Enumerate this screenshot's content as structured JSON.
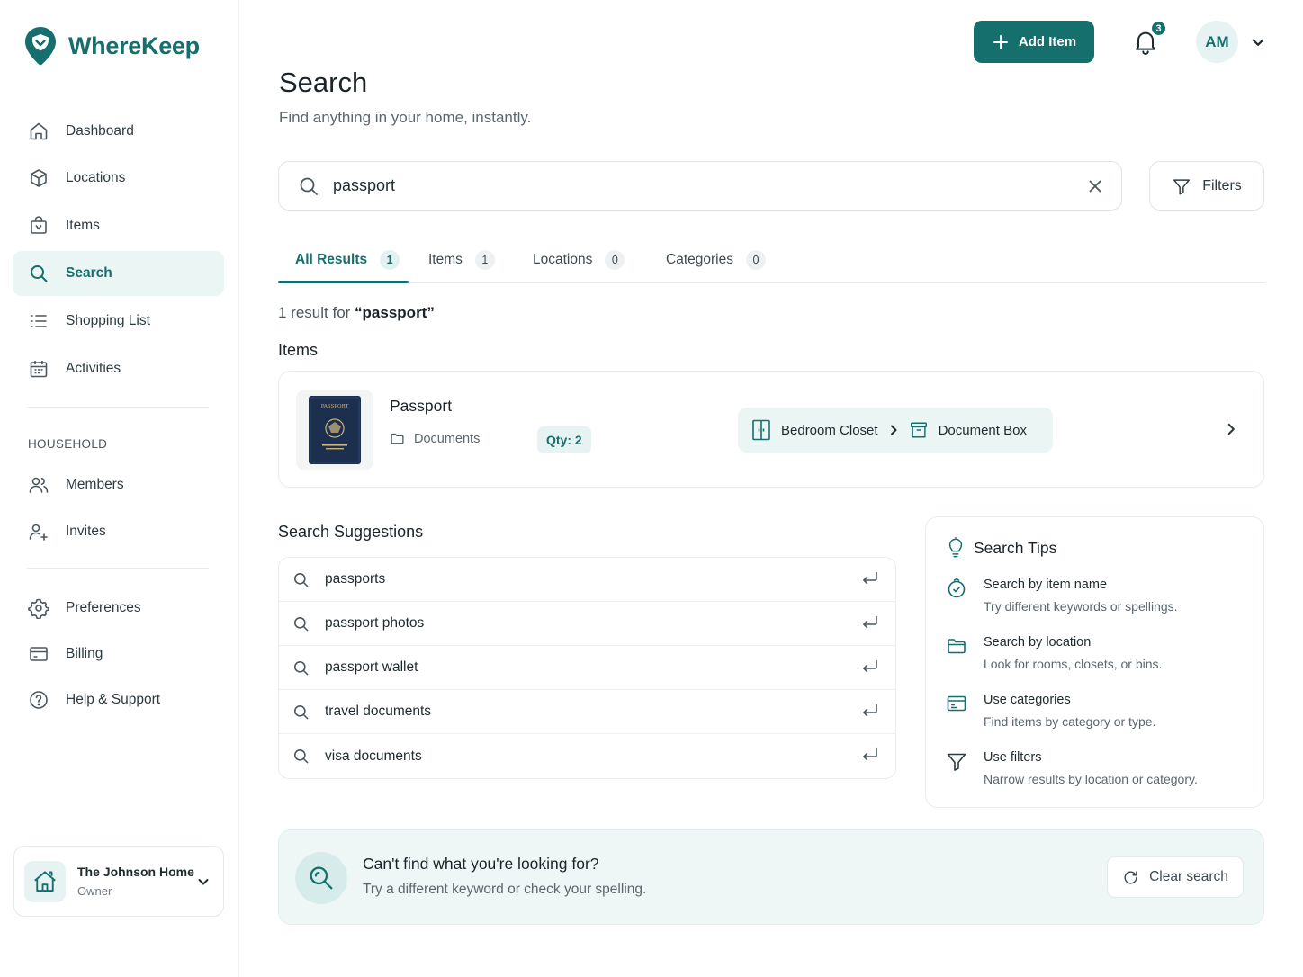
{
  "brand": {
    "name": "WhereKeep",
    "color": "#156f6c"
  },
  "sidebar": {
    "items": [
      {
        "label": "Dashboard",
        "icon": "home-icon"
      },
      {
        "label": "Locations",
        "icon": "cube-icon"
      },
      {
        "label": "Items",
        "icon": "bag-icon"
      },
      {
        "label": "Search",
        "icon": "search-icon",
        "active": true
      },
      {
        "label": "Shopping List",
        "icon": "list-icon"
      },
      {
        "label": "Activities",
        "icon": "calendar-icon"
      }
    ],
    "section_label": "HOUSEHOLD",
    "household_items": [
      {
        "label": "Members",
        "icon": "users-icon"
      },
      {
        "label": "Invites",
        "icon": "user-plus-icon"
      }
    ],
    "bottom_items": [
      {
        "label": "Preferences",
        "icon": "gear-icon"
      },
      {
        "label": "Billing",
        "icon": "credit-card-icon"
      },
      {
        "label": "Help & Support",
        "icon": "help-circle-icon"
      }
    ],
    "household": {
      "name": "The Johnson Home",
      "role": "Owner"
    }
  },
  "header": {
    "add_item_label": "Add Item",
    "notification_count": "3",
    "avatar_initials": "AM"
  },
  "page": {
    "title": "Search",
    "subtitle": "Find anything in your home, instantly."
  },
  "search": {
    "value": "passport",
    "filters_label": "Filters"
  },
  "tabs": [
    {
      "label": "All Results",
      "count": "1",
      "active": true
    },
    {
      "label": "Items",
      "count": "1"
    },
    {
      "label": "Locations",
      "count": "0"
    },
    {
      "label": "Categories",
      "count": "0"
    }
  ],
  "results": {
    "count_prefix": "1 result for ",
    "count_query": "“passport”",
    "items_heading": "Items",
    "item": {
      "name": "Passport",
      "category": "Documents",
      "qty": "Qty: 2",
      "thumb_text": "PASSPORT",
      "location_path": [
        "Bedroom Closet",
        "Document Box"
      ]
    }
  },
  "suggestions": {
    "heading": "Search Suggestions",
    "items": [
      "passports",
      "passport photos",
      "passport wallet",
      "travel documents",
      "visa documents"
    ]
  },
  "tips": {
    "title": "Search Tips",
    "items": [
      {
        "title": "Search by item name",
        "desc": "Try different keywords or spellings.",
        "icon": "tag-icon"
      },
      {
        "title": "Search by location",
        "desc": "Look for rooms, closets, or bins.",
        "icon": "folder-icon"
      },
      {
        "title": "Use categories",
        "desc": "Find items by category or type.",
        "icon": "category-icon"
      },
      {
        "title": "Use filters",
        "desc": "Narrow results by location or category.",
        "icon": "filter-icon"
      }
    ]
  },
  "cta": {
    "title": "Can't find what you're looking for?",
    "desc": "Try a different keyword or check your spelling.",
    "clear_label": "Clear search"
  }
}
